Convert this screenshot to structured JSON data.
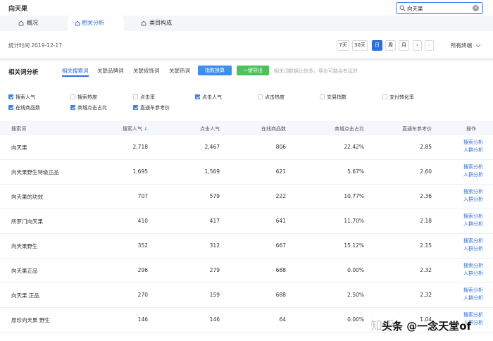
{
  "header": {
    "app_title": "向天果",
    "search_value": "向天果"
  },
  "nav_tabs": [
    {
      "label": "概况",
      "active": false
    },
    {
      "label": "相关分析",
      "active": true
    },
    {
      "label": "类目构成",
      "active": false
    }
  ],
  "stat_bar": {
    "label": "统计时间 2019-12-17",
    "range_buttons": [
      "7天",
      "30天",
      "日",
      "周",
      "月"
    ],
    "active_range": "日",
    "prev": "‹",
    "next": "›",
    "terminal_select": "所有终端"
  },
  "panel": {
    "title": "相关词分析",
    "subtabs": [
      "相关搜索词",
      "关联品牌词",
      "关联修饰词",
      "关联热词"
    ],
    "active_subtab": 0,
    "index_button": "指数换算",
    "export_button": "一键导出",
    "note": "相关词数据比较多，导出可能会有延时"
  },
  "metrics": [
    {
      "label": "搜索人气",
      "checked": true
    },
    {
      "label": "搜索热度",
      "checked": false
    },
    {
      "label": "点击率",
      "checked": false
    },
    {
      "label": "点击人气",
      "checked": true
    },
    {
      "label": "点击热度",
      "checked": false
    },
    {
      "label": "交易指数",
      "checked": false
    },
    {
      "label": "支付转化率",
      "checked": false
    },
    {
      "label": "在线商品数",
      "checked": true
    },
    {
      "label": "商城点击占比",
      "checked": true
    },
    {
      "label": "直通车参考价",
      "checked": true
    }
  ],
  "table": {
    "columns": [
      "搜索词",
      "搜索人气",
      "点击人气",
      "在线商品数",
      "商城点击占比",
      "直通车参考价",
      "操作"
    ],
    "sort_icon": "↓",
    "action_links": [
      "搜索分析",
      "人群分析"
    ],
    "rows": [
      [
        "向天果",
        "2,718",
        "2,467",
        "806",
        "22.42%",
        "2.85"
      ],
      [
        "向天果野生特级正品",
        "1,695",
        "1,569",
        "621",
        "5.67%",
        "2.60"
      ],
      [
        "向天果的功效",
        "707",
        "579",
        "222",
        "10.77%",
        "2.36"
      ],
      [
        "所罗门向天果",
        "410",
        "417",
        "641",
        "11.70%",
        "2.18"
      ],
      [
        "向天果野生",
        "352",
        "312",
        "667",
        "15.12%",
        "2.15"
      ],
      [
        "向天果正品",
        "296",
        "279",
        "688",
        "0.00%",
        "2.32"
      ],
      [
        "向天果 正品",
        "270",
        "159",
        "688",
        "2.50%",
        "2.32"
      ],
      [
        "原珍向天果 野生",
        "146",
        "146",
        "64",
        "0.00%",
        "1.04"
      ]
    ]
  },
  "watermark": "知乎",
  "watermark2": "头条 @一念天堂of",
  "icons": [
    "house-icon",
    "search-icon",
    "clear-icon",
    "chevron-down-icon",
    "sort-down-icon"
  ],
  "colors": {
    "accent": "#2d6de0",
    "export_green": "#4cc35a"
  }
}
